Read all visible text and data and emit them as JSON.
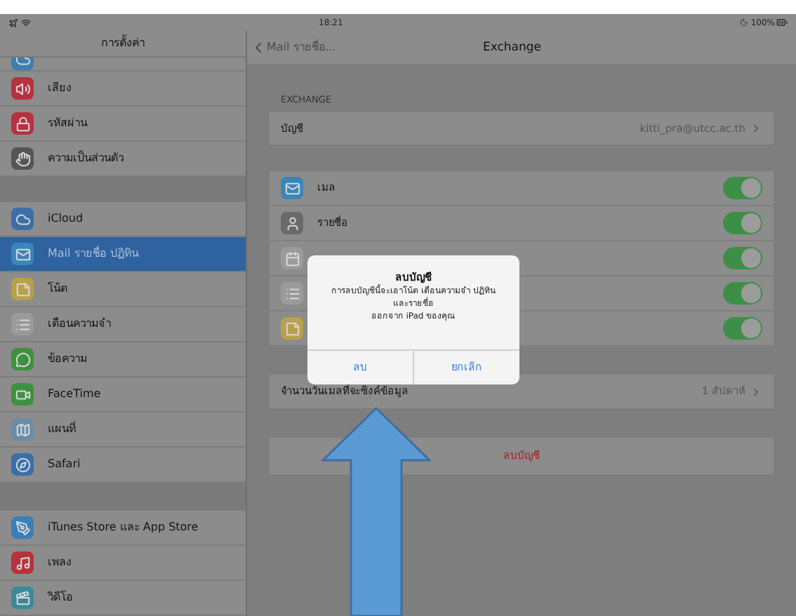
{
  "status_bar": {
    "time": "18:21",
    "battery": "100%"
  },
  "sidebar": {
    "title": "การตั้งค่า",
    "groups": [
      [
        {
          "kind": "partial",
          "selected": false
        },
        {
          "kind": "sound",
          "label": "เสียง",
          "selected": false
        },
        {
          "kind": "passcode",
          "label": "รหัสผ่าน",
          "selected": false
        },
        {
          "kind": "privacy",
          "label": "ความเป็นส่วนตัว",
          "selected": false
        }
      ],
      [
        {
          "kind": "icloud",
          "label": "iCloud",
          "selected": false
        },
        {
          "kind": "mail",
          "label": "Mail รายชื่อ ปฏิทิน",
          "selected": true
        },
        {
          "kind": "notes",
          "label": "โน้ต",
          "selected": false
        },
        {
          "kind": "reminders",
          "label": "เตือนความจำ",
          "selected": false
        },
        {
          "kind": "messages",
          "label": "ข้อความ",
          "selected": false
        },
        {
          "kind": "facetime",
          "label": "FaceTime",
          "selected": false
        },
        {
          "kind": "maps",
          "label": "แผนที่",
          "selected": false
        },
        {
          "kind": "safari",
          "label": "Safari",
          "selected": false
        }
      ],
      [
        {
          "kind": "appstore",
          "label": "iTunes Store และ App Store",
          "selected": false
        },
        {
          "kind": "music",
          "label": "เพลง",
          "selected": false
        },
        {
          "kind": "videos",
          "label": "วิดีโอ",
          "selected": false
        }
      ]
    ]
  },
  "detail": {
    "back": "Mail รายชื่อ...",
    "title": "Exchange",
    "section": "EXCHANGE",
    "account": {
      "label": "บัญชี",
      "value": "kitti_pra@utcc.ac.th"
    },
    "services": [
      {
        "kind": "mail",
        "label": "เมล",
        "on": true
      },
      {
        "kind": "contacts",
        "label": "รายชื่อ",
        "on": true
      },
      {
        "kind": "calendar",
        "on": true
      },
      {
        "kind": "reminders",
        "on": true
      },
      {
        "kind": "notes",
        "on": true
      }
    ],
    "sync": {
      "label": "จำนวนวันเมลที่จะซิงค์ข้อมูล",
      "value": "1 สัปดาห์"
    },
    "delete": "ลบบัญชี"
  },
  "alert": {
    "title": "ลบบัญชี",
    "message": [
      "การลบบัญชีนี้จะเอาโน้ต เตือนความจำ ปฏิทิน",
      "และรายชื่อ",
      "ออกจาก iPad ของคุณ"
    ],
    "buttons": [
      "ลบ",
      "ยกเลิก"
    ]
  }
}
